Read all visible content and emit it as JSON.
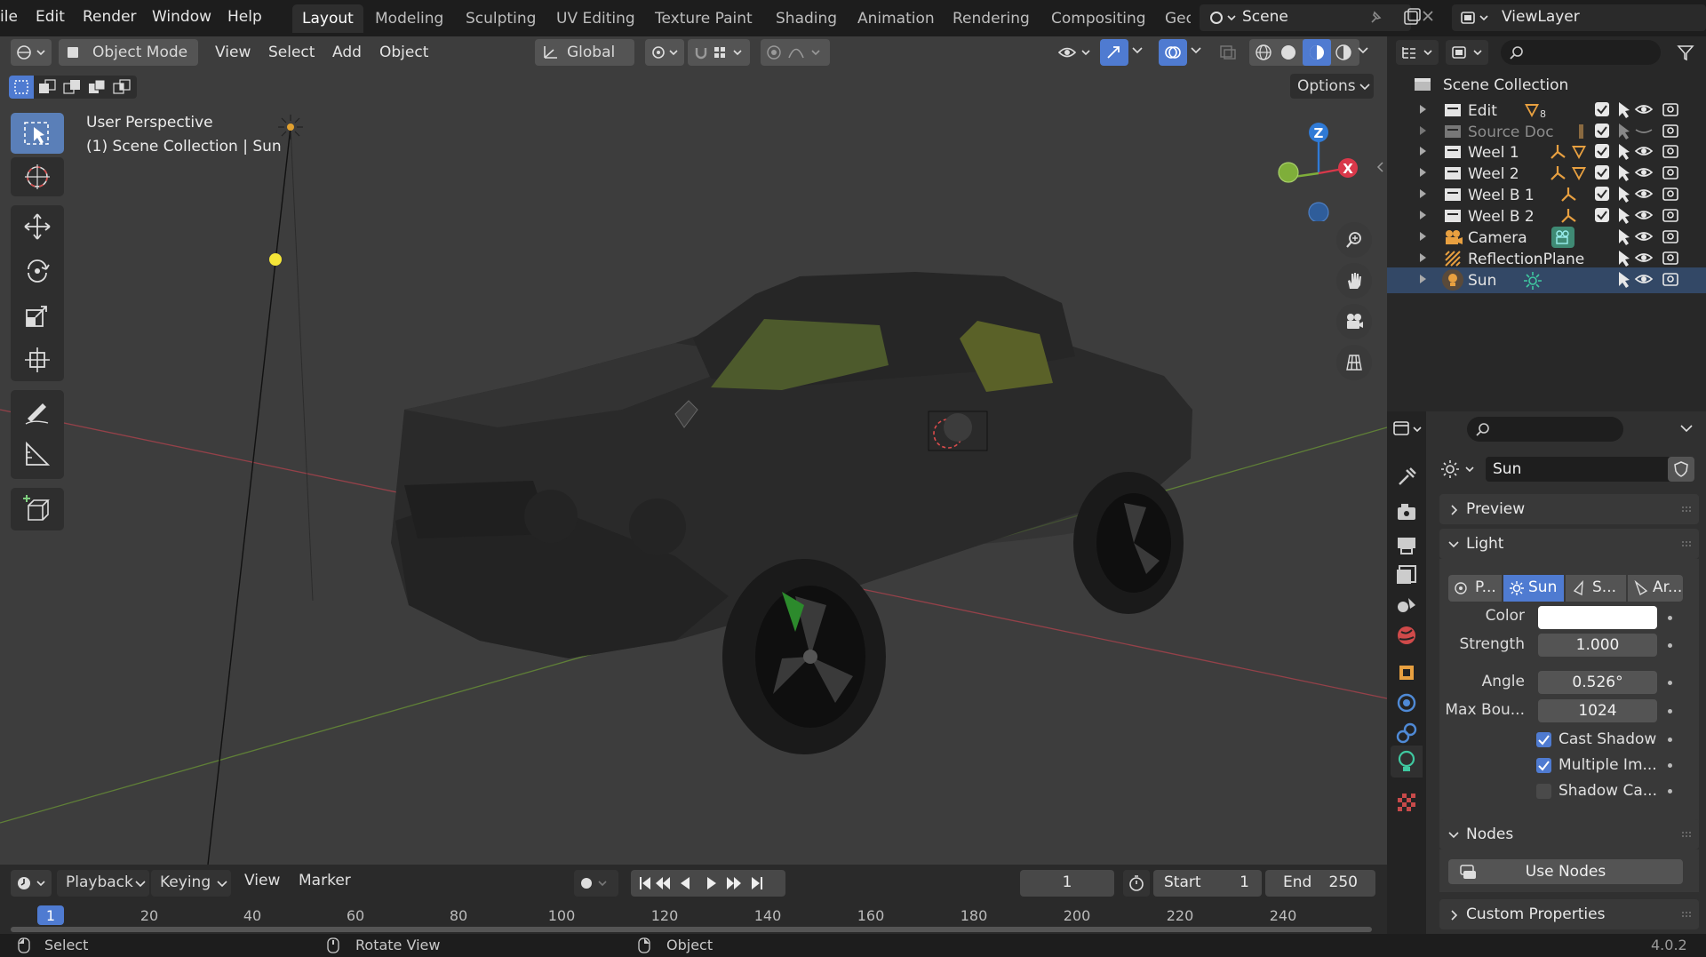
{
  "topbar": {
    "menus": [
      "ile",
      "Edit",
      "Render",
      "Window",
      "Help"
    ],
    "workspaces": [
      "Layout",
      "Modeling",
      "Sculpting",
      "UV Editing",
      "Texture Paint",
      "Shading",
      "Animation",
      "Rendering",
      "Compositing",
      "Geo"
    ],
    "active_workspace": "Layout",
    "scene": "Scene",
    "view_layer": "ViewLayer"
  },
  "viewport": {
    "mode": "Object Mode",
    "menus": [
      "View",
      "Select",
      "Add",
      "Object"
    ],
    "transform_orientation": "Global",
    "options_label": "Options",
    "overlay_line1": "User Perspective",
    "overlay_line2": "(1) Scene Collection | Sun",
    "gizmo_axes": [
      "Z",
      "X"
    ]
  },
  "outliner": {
    "root": "Scene Collection",
    "items": [
      {
        "label": "Edit",
        "badge": "8",
        "dim": false
      },
      {
        "label": "Source Doc",
        "dim": true
      },
      {
        "label": "Weel 1",
        "dim": false
      },
      {
        "label": "Weel 2",
        "dim": false
      },
      {
        "label": "Weel B 1",
        "dim": false
      },
      {
        "label": "Weel B 2",
        "dim": false
      },
      {
        "label": "Camera",
        "dim": false
      },
      {
        "label": "ReflectionPlane",
        "dim": false
      },
      {
        "label": "Sun",
        "dim": false
      }
    ]
  },
  "properties": {
    "object_name": "Sun",
    "panels": {
      "preview": "Preview",
      "light": "Light",
      "nodes": "Nodes",
      "custom": "Custom Properties"
    },
    "light_types": [
      "P...",
      "Sun",
      "S...",
      "Ar..."
    ],
    "active_light_type": "Sun",
    "fields": {
      "color_label": "Color",
      "color_value": "#ffffff",
      "strength_label": "Strength",
      "strength": "1.000",
      "angle_label": "Angle",
      "angle": "0.526°",
      "max_bounces_label": "Max Bou...",
      "max_bounces": "1024"
    },
    "checkboxes": [
      {
        "label": "Cast Shadow",
        "checked": true
      },
      {
        "label": "Multiple Im...",
        "checked": true
      },
      {
        "label": "Shadow Ca...",
        "checked": false
      }
    ],
    "use_nodes": "Use Nodes"
  },
  "timeline": {
    "menus": [
      "Playback",
      "Keying",
      "View",
      "Marker"
    ],
    "current_frame": "1",
    "start_label": "Start",
    "start": "1",
    "end_label": "End",
    "end": "250",
    "ruler": [
      "1",
      "20",
      "40",
      "60",
      "80",
      "100",
      "120",
      "140",
      "160",
      "180",
      "200",
      "220",
      "240"
    ]
  },
  "statusbar": {
    "hint1": "Select",
    "hint2": "Rotate View",
    "hint3": "Object",
    "version": "4.0.2"
  },
  "colors": {
    "accent": "#4f7bd1",
    "viewport_bg": "#3d3d3d",
    "x_axis": "#d9384a",
    "y_axis": "#7fae3a",
    "z_axis": "#2f7ad6"
  }
}
